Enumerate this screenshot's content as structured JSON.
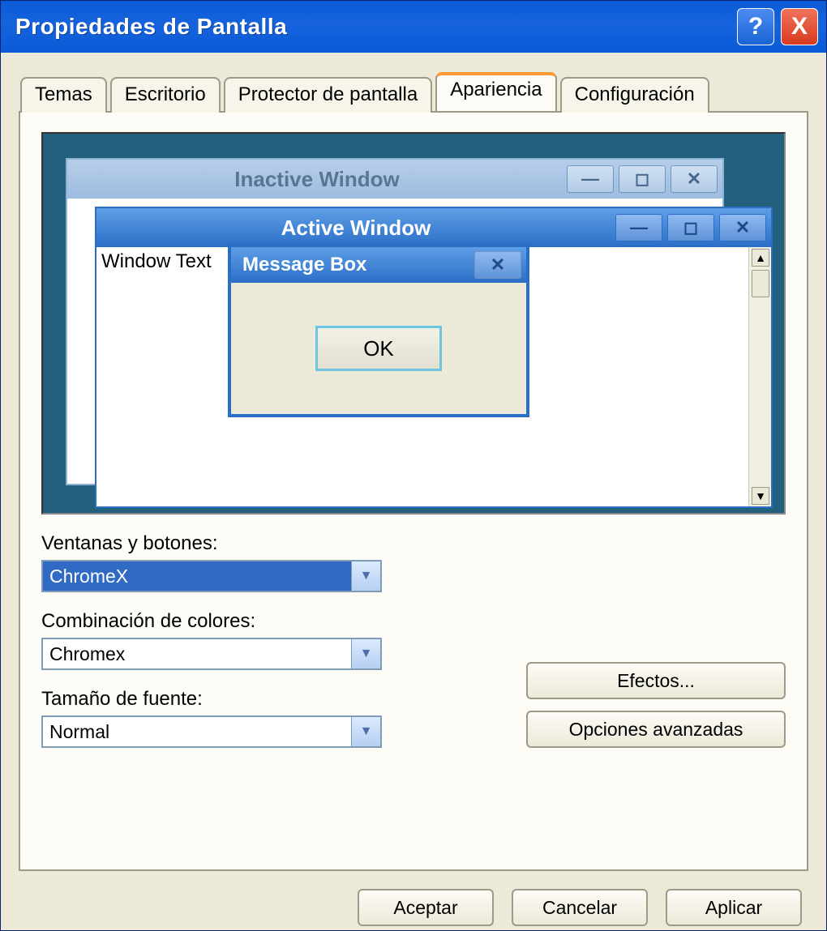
{
  "window": {
    "title": "Propiedades de Pantalla"
  },
  "tabs": {
    "temas": "Temas",
    "escritorio": "Escritorio",
    "protector": "Protector de pantalla",
    "apariencia": "Apariencia",
    "config": "Configuración"
  },
  "preview": {
    "inactive_title": "Inactive Window",
    "active_title": "Active Window",
    "window_text": "Window Text",
    "msgbox_title": "Message Box",
    "ok": "OK"
  },
  "labels": {
    "windows_buttons": "Ventanas y botones:",
    "color_scheme": "Combinación de colores:",
    "font_size": "Tamaño de fuente:"
  },
  "selects": {
    "windows_buttons": "ChromeX",
    "color_scheme": "Chromex",
    "font_size": "Normal"
  },
  "buttons": {
    "effects": "Efectos...",
    "advanced": "Opciones avanzadas",
    "ok": "Aceptar",
    "cancel": "Cancelar",
    "apply": "Aplicar"
  },
  "icons": {
    "help": "?",
    "close": "X",
    "min": "—",
    "max": "◻",
    "x": "✕",
    "down": "▼",
    "up": "▲"
  }
}
